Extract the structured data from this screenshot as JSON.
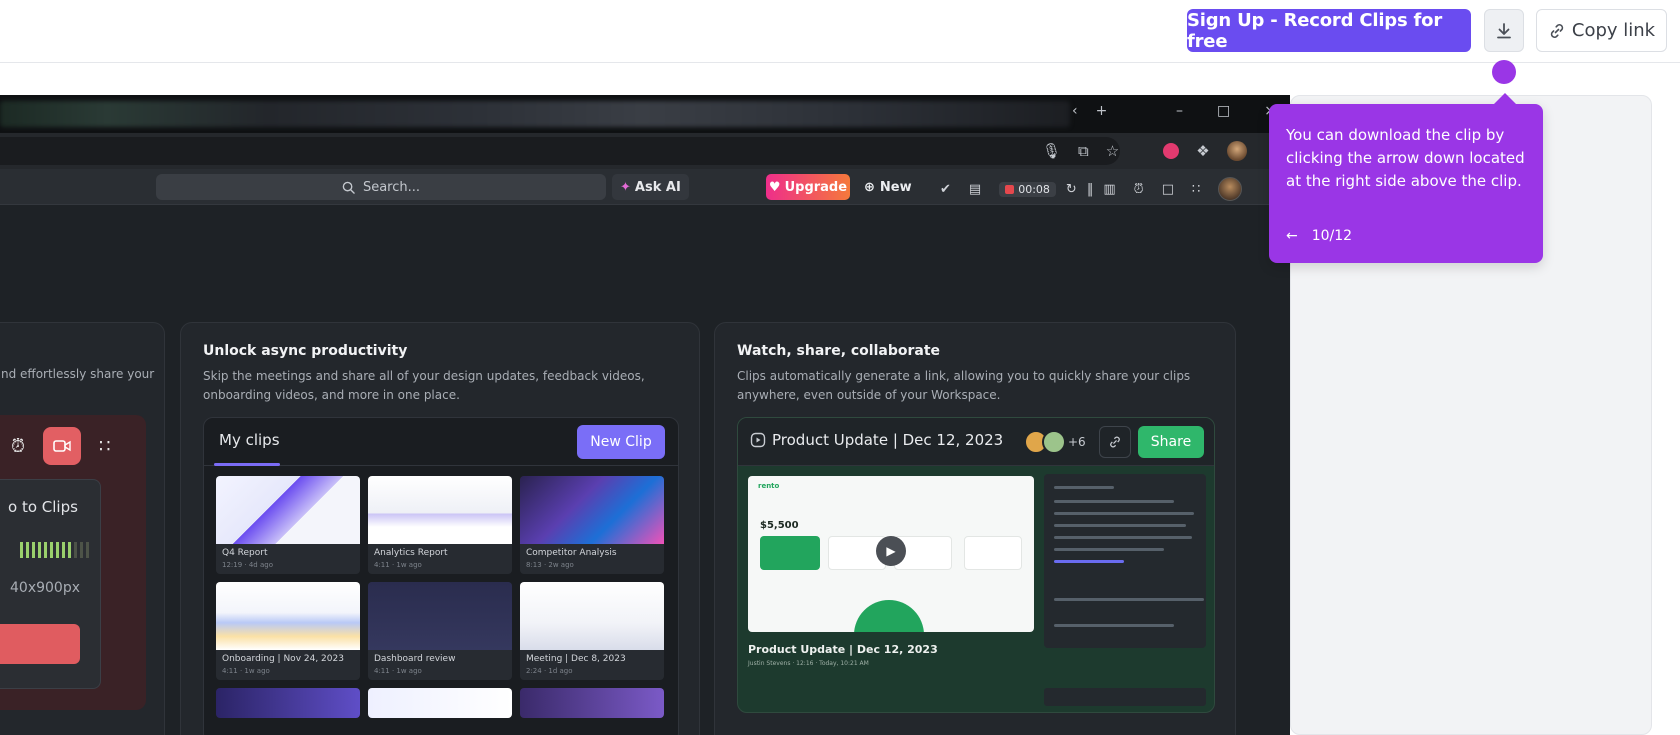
{
  "topbar": {
    "signup_label": "Sign Up - Record Clips for free",
    "copy_link_label": "Copy link"
  },
  "browser": {
    "tab_close": "‹",
    "tab_add": "+",
    "win_minimize": "–",
    "win_maximize": "□",
    "win_close": "×"
  },
  "app_toolbar": {
    "search_placeholder": "Search...",
    "ask_ai_label": "Ask AI",
    "upgrade_label": "Upgrade",
    "new_label": "New",
    "timer": "00:08"
  },
  "left_card": {
    "description": "nd effortlessly share your",
    "panel_title": "o to Clips",
    "resolution": "40x900px"
  },
  "mid_card": {
    "title": "Unlock async productivity",
    "description": "Skip the meetings and share all of your design updates, feedback videos, onboarding videos, and more in one place.",
    "tab_label": "My clips",
    "new_clip_label": "New Clip",
    "clips": [
      {
        "name": "Q4 Report",
        "meta": "12:19 · 4d ago"
      },
      {
        "name": "Analytics Report",
        "meta": "4:11 · 1w ago"
      },
      {
        "name": "Competitor Analysis",
        "meta": "8:13 · 2w ago"
      },
      {
        "name": "Onboarding | Nov 24, 2023",
        "meta": "4:11 · 1w ago"
      },
      {
        "name": "Dashboard review",
        "meta": "4:11 · 1w ago"
      },
      {
        "name": "Meeting | Dec 8, 2023",
        "meta": "2:24 · 1d ago"
      }
    ]
  },
  "right_card": {
    "title": "Watch, share, collaborate",
    "description": "Clips automatically generate a link, allowing you to quickly share your clips anywhere, even outside of your Workspace.",
    "clip_title": "Product Update | Dec 12, 2023",
    "viewer_count": "+6",
    "share_label": "Share",
    "video_caption": "Product Update | Dec 12, 2023",
    "video_sub": "Justin Stevens · 12:16 · Today, 10:21 AM",
    "brand": "rento",
    "amount": "$5,500"
  },
  "tooltip": {
    "text": "You can download the clip by clicking the arrow down located at  the right side above the clip.",
    "step": "10/12"
  },
  "colors": {
    "primary": "#6a4cf0",
    "tooltip": "#9a36e6",
    "share_green": "#2fb76b",
    "upgrade_pink": "#ee2e8a"
  }
}
